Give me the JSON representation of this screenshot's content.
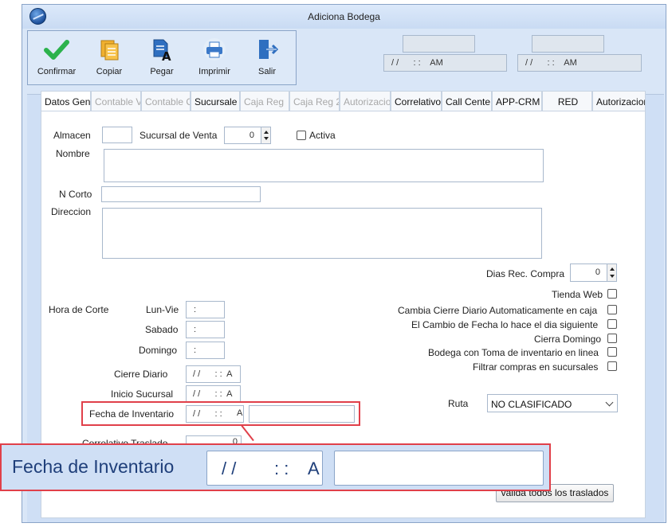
{
  "window": {
    "title": "Adiciona Bodega"
  },
  "toolbar": {
    "confirmar": "Confirmar",
    "copiar": "Copiar",
    "pegar": "Pegar",
    "imprimir": "Imprimir",
    "salir": "Salir"
  },
  "timestamps": {
    "left": "/ /      : :    AM",
    "right": "/ /      : :    AM"
  },
  "tabs": [
    {
      "label": "Datos Gen",
      "state": "active"
    },
    {
      "label": "Contable V",
      "state": "disabled"
    },
    {
      "label": "Contable C",
      "state": "disabled"
    },
    {
      "label": "Sucursale",
      "state": "enabled"
    },
    {
      "label": "Caja Reg",
      "state": "disabled"
    },
    {
      "label": "Caja Reg 2",
      "state": "disabled"
    },
    {
      "label": "Autorizacio",
      "state": "disabled"
    },
    {
      "label": "Correlativo",
      "state": "enabled"
    },
    {
      "label": "Call Cente",
      "state": "enabled"
    },
    {
      "label": "APP-CRM",
      "state": "enabled"
    },
    {
      "label": "RED",
      "state": "enabled"
    },
    {
      "label": "Autorizacion",
      "state": "enabled"
    }
  ],
  "form": {
    "almacen_label": "Almacen",
    "sucursal_venta_label": "Sucursal de Venta",
    "sucursal_venta_value": "0",
    "activa_label": "Activa",
    "nombre_label": "Nombre",
    "ncorto_label": "N Corto",
    "direccion_label": "Direccion",
    "dias_rec_label": "Dias Rec. Compra",
    "dias_rec_value": "0",
    "hora_corte_label": "Hora de Corte",
    "lunvie_label": "Lun-Vie",
    "sabado_label": "Sabado",
    "domingo_label": "Domingo",
    "time_value": ":",
    "cierre_diario_label": "Cierre Diario",
    "inicio_sucursal_label": "Inicio Sucursal",
    "fecha_inventario_label": "Fecha de Inventario",
    "datetime_value": "/ /      : :  A",
    "fecha_inv_date": "/ /      : :",
    "fecha_inv_ampm": "A",
    "correlativo_label": "Correlativo Traslado",
    "correlativo_value": "0",
    "ruta_label": "Ruta",
    "ruta_value": "NO CLASIFICADO",
    "valida_button": "valida todos los traslados"
  },
  "checkboxes": [
    "Tienda Web",
    "Cambia Cierre Diario Automaticamente en caja",
    "El Cambio de Fecha lo hace el dia siguiente",
    "Cierra Domingo",
    "Bodega con Toma de inventario en linea",
    "Filtrar compras en sucursales"
  ],
  "zoom": {
    "label": "Fecha de Inventario",
    "date": "/ /",
    "time": ": :",
    "ampm": "A"
  },
  "colors": {
    "accent": "#e0404a",
    "panel": "#cfdff5",
    "window": "#d9e6f7"
  }
}
